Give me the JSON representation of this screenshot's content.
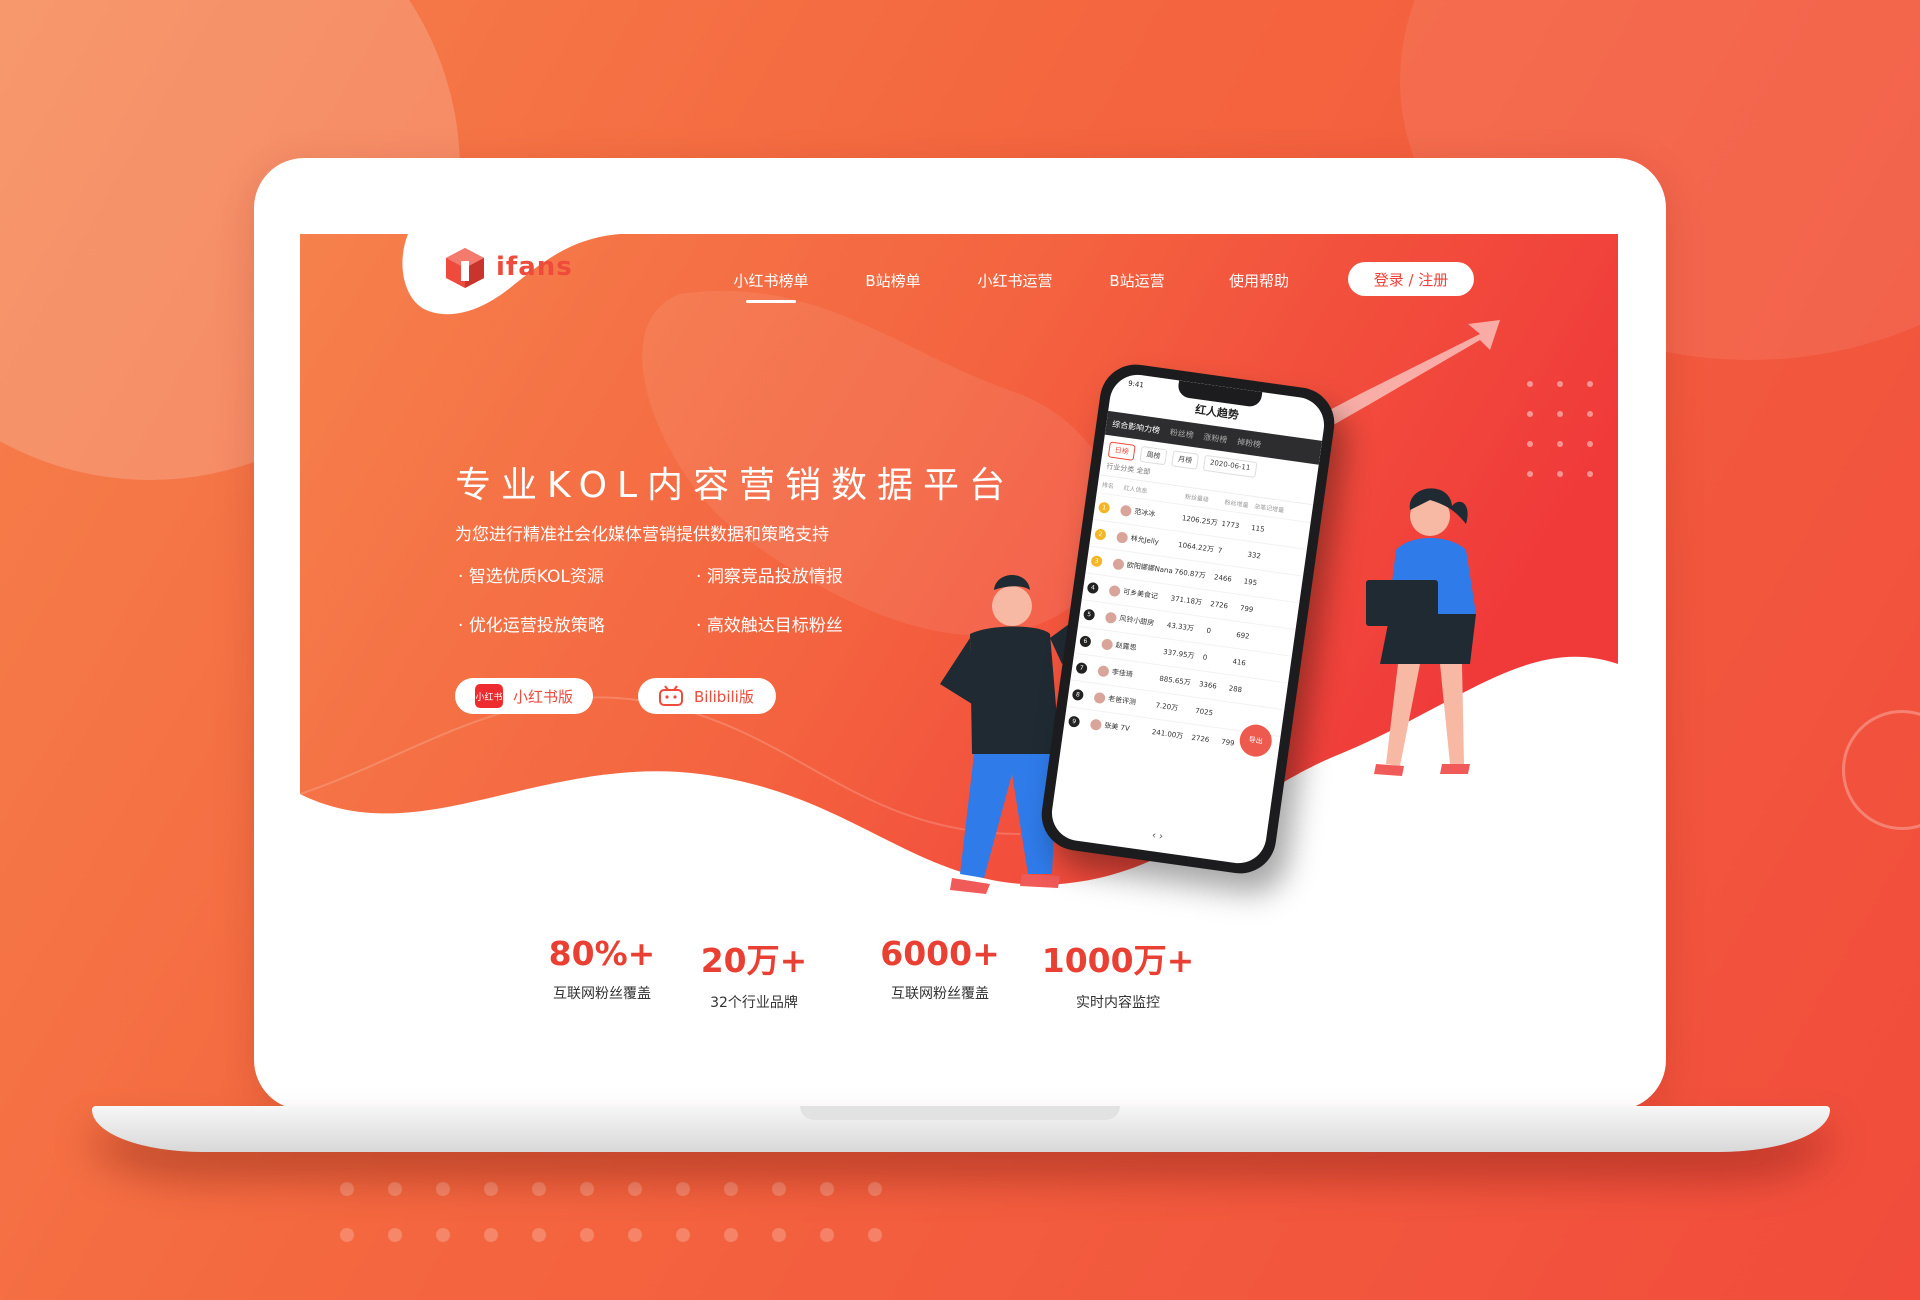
{
  "logo": {
    "text": "ifans"
  },
  "nav": {
    "items": [
      {
        "label": "小红书榜单",
        "active": true
      },
      {
        "label": "B站榜单",
        "active": false
      },
      {
        "label": "小红书运营",
        "active": false
      },
      {
        "label": "B站运营",
        "active": false
      },
      {
        "label": "使用帮助",
        "active": false
      }
    ],
    "login_label": "登录 / 注册"
  },
  "hero": {
    "headline": "专业KOL内容营销数据平台",
    "subline": "为您进行精准社会化媒体营销提供数据和策略支持",
    "features": [
      "智选优质KOL资源",
      "洞察竞品投放情报",
      "优化运营投放策略",
      "高效触达目标粉丝"
    ],
    "buttons": {
      "xhs_label": "小红书版",
      "xhs_icon_text": "小红书",
      "bili_label": "Bilibili版"
    }
  },
  "stats": [
    {
      "value": "80%+",
      "label": "互联网粉丝覆盖"
    },
    {
      "value": "20万+",
      "label": "32个行业品牌"
    },
    {
      "value": "6000+",
      "label": "互联网粉丝覆盖"
    },
    {
      "value": "1000万+",
      "label": "实时内容监控"
    }
  ],
  "phone": {
    "time": "9:41",
    "title": "红人趋势",
    "tabs": [
      "综合影响力榜",
      "粉丝榜",
      "涨粉榜",
      "掉粉榜"
    ],
    "chips": [
      "日榜",
      "周榜",
      "月榜",
      "2020-06-11"
    ],
    "filter": "行业分类 全部",
    "headers": [
      "排名",
      "红人信息",
      "粉丝量级",
      "粉丝增量",
      "总笔记增量"
    ],
    "rows": [
      {
        "rank": "1",
        "name": "范冰冰",
        "fans": "1206.25万",
        "inc": "1773",
        "notes": "115"
      },
      {
        "rank": "2",
        "name": "林允Jelly",
        "fans": "1064.22万",
        "inc": "7",
        "notes": "332"
      },
      {
        "rank": "3",
        "name": "欧阳娜娜Nana",
        "fans": "760.87万",
        "inc": "2466",
        "notes": "195"
      },
      {
        "rank": "4",
        "name": "可乡美食记",
        "fans": "371.18万",
        "inc": "2726",
        "notes": "799"
      },
      {
        "rank": "5",
        "name": "风铃小甜房",
        "fans": "43.33万",
        "inc": "0",
        "notes": "692"
      },
      {
        "rank": "6",
        "name": "赵露思",
        "fans": "337.95万",
        "inc": "0",
        "notes": "416"
      },
      {
        "rank": "7",
        "name": "李佳琦",
        "fans": "885.65万",
        "inc": "3366",
        "notes": "288"
      },
      {
        "rank": "8",
        "name": "老爸评测",
        "fans": "7.20万",
        "inc": "7025",
        "notes": ""
      },
      {
        "rank": "9",
        "name": "张美 7V",
        "fans": "241.00万",
        "inc": "2726",
        "notes": "799"
      }
    ],
    "export_label": "导出",
    "pager": "‹    ›"
  },
  "colors": {
    "accent": "#ef4b3c",
    "stat": "#ea3f33",
    "bg_start": "#f6814c",
    "bg_end": "#f14c3c"
  }
}
